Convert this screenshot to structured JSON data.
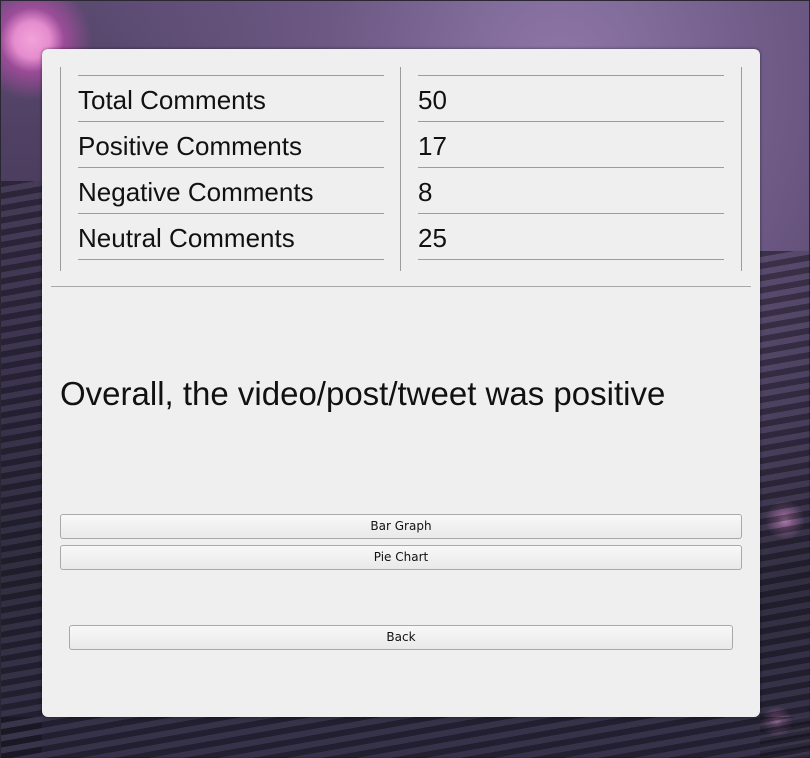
{
  "stats": {
    "rows": [
      {
        "label": "Total Comments",
        "value": "50"
      },
      {
        "label": "Positive Comments",
        "value": "17"
      },
      {
        "label": "Negative Comments",
        "value": "8"
      },
      {
        "label": "Neutral Comments",
        "value": "25"
      }
    ]
  },
  "summary": {
    "text": "Overall, the video/post/tweet was positive"
  },
  "buttons": {
    "bar_graph": "Bar Graph",
    "pie_chart": "Pie Chart",
    "back": "Back"
  }
}
